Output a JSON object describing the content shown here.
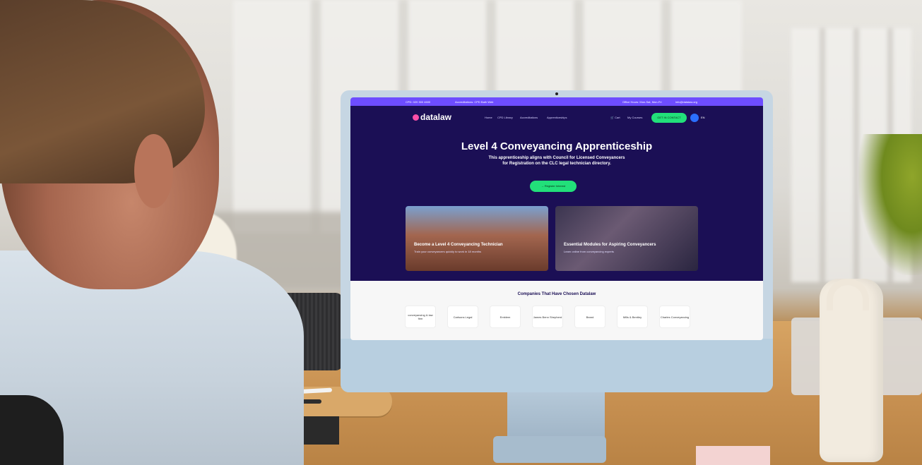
{
  "website": {
    "topbar": {
      "phone": "CPD: 020 300 4600",
      "accreditation": "Accreditations: CPD Bath Web",
      "office_hours": "Office Hours: Mon-Sat, Mon-Fri",
      "email": "info@datalaw.org"
    },
    "logo": "datalaw",
    "nav": [
      "Home",
      "CPD Library",
      "Accreditations",
      "Apprenticeships"
    ],
    "cart": "Cart",
    "my_courses": "My Courses",
    "cta_small": "GET IN CONTACT",
    "language": "EN",
    "hero": {
      "title": "Level 4 Conveyancing Apprenticeship",
      "subtitle_line1": "This apprenticeship aligns with Council for Licensed Conveyancers",
      "subtitle_line2": "for Registration on the CLC legal technician directory.",
      "button": "→ Register Interest"
    },
    "cards": [
      {
        "title": "Become a Level 4 Conveyancing Technician",
        "subtitle": "Train your conveyancers quickly to work in 18 months"
      },
      {
        "title": "Essential Modules for Aspiring Conveyancers",
        "subtitle": "Learn online from conveyancing experts"
      }
    ],
    "clients_title": "Companies That Have Chosen Datalaw",
    "clients": [
      "conveyancing & law firm",
      "Carlsons Legal",
      "Emblem",
      "James Benn Shepherd",
      "Beard",
      "Mills & Bentley",
      "Charles Conveyancing"
    ]
  }
}
